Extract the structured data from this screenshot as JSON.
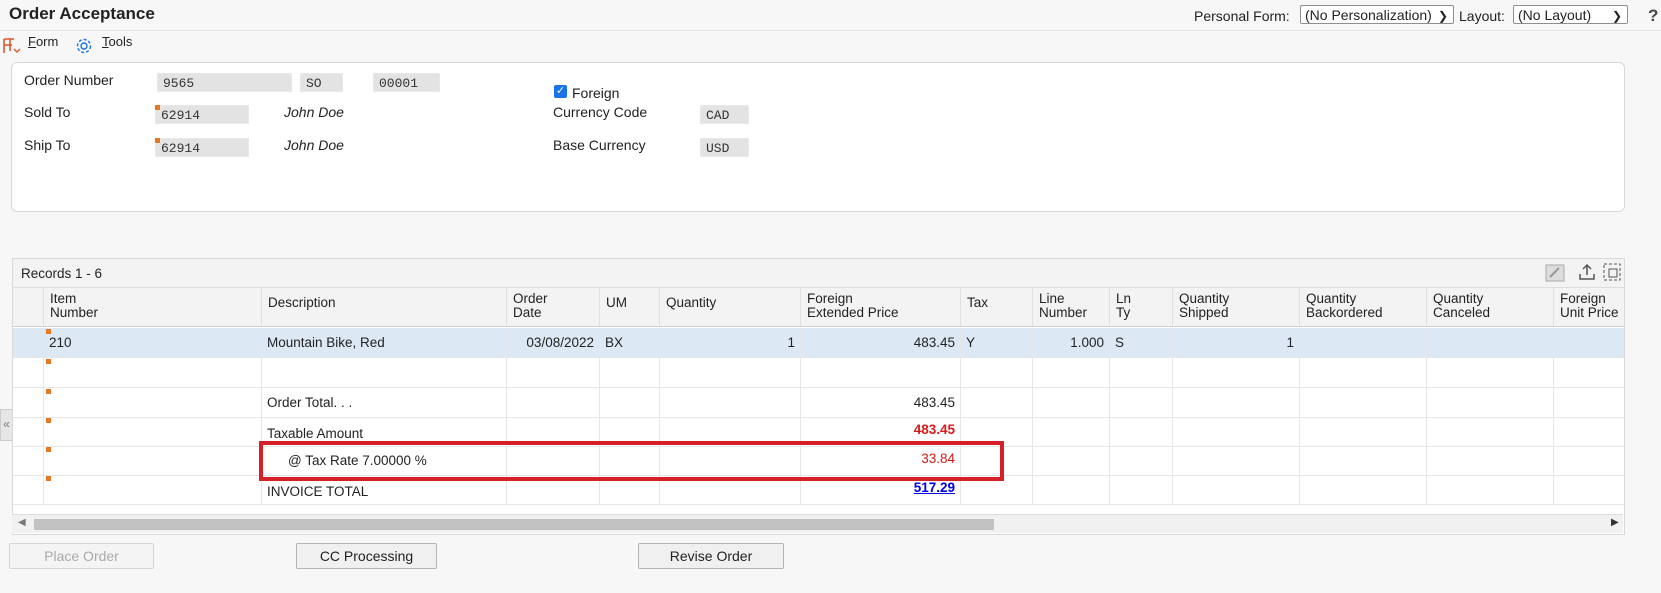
{
  "app": {
    "title": "Order Acceptance",
    "personal_form_label": "Personal Form:",
    "personal_form_value": "(No Personalization)",
    "layout_label": "Layout:",
    "layout_value": "(No Layout)",
    "help_glyph": "?"
  },
  "menu": {
    "form_label": "orm",
    "form_accel": "F",
    "tools_label": "ools",
    "tools_accel": "T"
  },
  "header": {
    "order_number_label": "Order Number",
    "order_number": "9565",
    "order_type": "SO",
    "order_company": "00001",
    "sold_to_label": "Sold To",
    "sold_to": "62914",
    "sold_to_name": "John Doe",
    "ship_to_label": "Ship To",
    "ship_to": "62914",
    "ship_to_name": "John Doe",
    "foreign_label": "Foreign",
    "foreign_checked": true,
    "currency_code_label": "Currency Code",
    "currency_code": "CAD",
    "base_currency_label": "Base Currency",
    "base_currency": "USD"
  },
  "grid": {
    "records_label": "Records 1 - 6",
    "columns": [
      {
        "l1": "Item",
        "l2": "Number"
      },
      {
        "l1": "Description",
        "l2": ""
      },
      {
        "l1": "Order",
        "l2": "Date"
      },
      {
        "l1": "UM",
        "l2": ""
      },
      {
        "l1": "Quantity",
        "l2": ""
      },
      {
        "l1": "Foreign",
        "l2": "Extended Price"
      },
      {
        "l1": "Tax",
        "l2": ""
      },
      {
        "l1": "Line",
        "l2": "Number"
      },
      {
        "l1": "Ln",
        "l2": "Ty"
      },
      {
        "l1": "Quantity",
        "l2": "Shipped"
      },
      {
        "l1": "Quantity",
        "l2": "Backordered"
      },
      {
        "l1": "Quantity",
        "l2": "Canceled"
      },
      {
        "l1": "Foreign",
        "l2": "Unit Price"
      }
    ],
    "row1": {
      "item": "210",
      "description": "Mountain Bike, Red",
      "order_date": "03/08/2022",
      "um": "BX",
      "quantity": "1",
      "ext_price": "483.45",
      "tax": "Y",
      "line_number": "1.000",
      "ln_ty": "S",
      "qty_shipped": "1"
    },
    "order_total_label": "Order Total. . .",
    "order_total": "483.45",
    "taxable_label": "Taxable Amount",
    "taxable": "483.45",
    "tax_rate_label": "@ Tax Rate 7.00000 %",
    "tax_amount": "33.84",
    "invoice_label": "INVOICE TOTAL",
    "invoice_total": "517.29"
  },
  "buttons": {
    "place_order": "Place Order",
    "cc_processing": "CC Processing",
    "revise_order": "Revise Order"
  },
  "colors": {
    "highlight": "#d62027",
    "required_marker": "#e87722",
    "link": "#0000ee",
    "negative_red": "#d61a1a"
  }
}
